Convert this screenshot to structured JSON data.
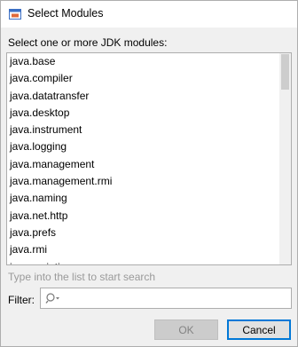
{
  "window": {
    "title": "Select Modules"
  },
  "caption": "Select one or more JDK modules:",
  "modules": [
    "java.base",
    "java.compiler",
    "java.datatransfer",
    "java.desktop",
    "java.instrument",
    "java.logging",
    "java.management",
    "java.management.rmi",
    "java.naming",
    "java.net.http",
    "java.prefs",
    "java.rmi",
    "java.scripting"
  ],
  "hint": "Type into the list to start search",
  "filter": {
    "label": "Filter:",
    "value": "",
    "placeholder": ""
  },
  "buttons": {
    "ok": "OK",
    "cancel": "Cancel"
  }
}
